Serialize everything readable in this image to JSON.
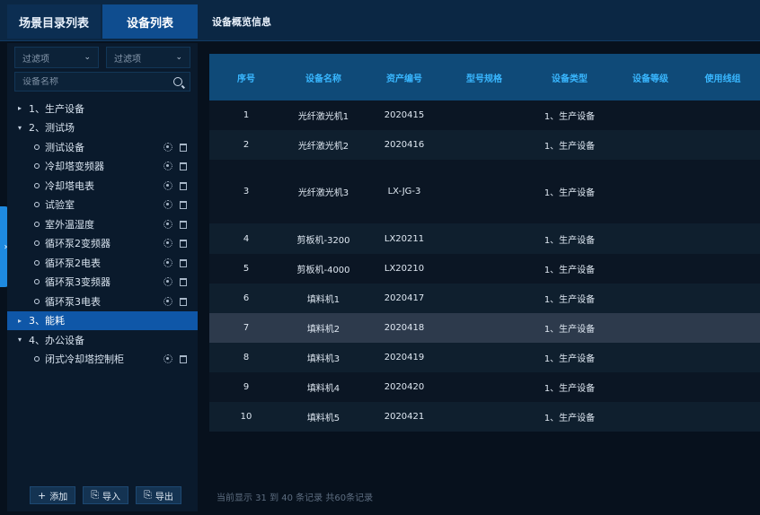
{
  "tabs": [
    "场景目录列表",
    "设备列表",
    "设备概览信息"
  ],
  "left": {
    "filters": [
      "过滤项",
      "过滤项"
    ],
    "search_placeholder": "设备名称",
    "tree": [
      {
        "label": "1、生产设备",
        "expanded": false,
        "children": []
      },
      {
        "label": "2、测试场",
        "expanded": true,
        "children": [
          "测试设备",
          "冷却塔变频器",
          "冷却塔电表",
          "试验室",
          "室外温湿度",
          "循环泵2变频器",
          "循环泵2电表",
          "循环泵3变频器",
          "循环泵3电表"
        ]
      },
      {
        "label": "3、能耗",
        "expanded": false,
        "selected": true,
        "children": []
      },
      {
        "label": "4、办公设备",
        "expanded": true,
        "children": [
          "闭式冷却塔控制柜"
        ]
      }
    ],
    "buttons": [
      {
        "icon": "+",
        "label": "添加"
      },
      {
        "icon": "⎘",
        "label": "导入"
      },
      {
        "icon": "⎘",
        "label": "导出"
      }
    ]
  },
  "table": {
    "columns": [
      "序号",
      "设备名称",
      "资产编号",
      "型号规格",
      "设备类型",
      "设备等级",
      "使用线组"
    ],
    "rows": [
      [
        "1",
        "光纤激光机1",
        "2020415",
        "",
        "1、生产设备",
        "",
        ""
      ],
      [
        "2",
        "光纤激光机2",
        "2020416",
        "",
        "1、生产设备",
        "",
        ""
      ],
      [
        "3",
        "光纤激光机3",
        "LX-JG-3",
        "",
        "1、生产设备",
        "",
        ""
      ],
      [
        "4",
        "剪板机-3200",
        "LX20211",
        "",
        "1、生产设备",
        "",
        ""
      ],
      [
        "5",
        "剪板机-4000",
        "LX20210",
        "",
        "1、生产设备",
        "",
        ""
      ],
      [
        "6",
        "填料机1",
        "2020417",
        "",
        "1、生产设备",
        "",
        ""
      ],
      [
        "7",
        "填料机2",
        "2020418",
        "",
        "1、生产设备",
        "",
        ""
      ],
      [
        "8",
        "填料机3",
        "2020419",
        "",
        "1、生产设备",
        "",
        ""
      ],
      [
        "9",
        "填料机4",
        "2020420",
        "",
        "1、生产设备",
        "",
        ""
      ],
      [
        "10",
        "填料机5",
        "2020421",
        "",
        "1、生产设备",
        "",
        ""
      ]
    ],
    "selected_row": 6
  },
  "footer": "当前显示 31 到 40 条记录 共60条记录",
  "colors": {
    "accent": "#0f57a8",
    "header_text": "#39b7ff",
    "background": "#07111d"
  }
}
